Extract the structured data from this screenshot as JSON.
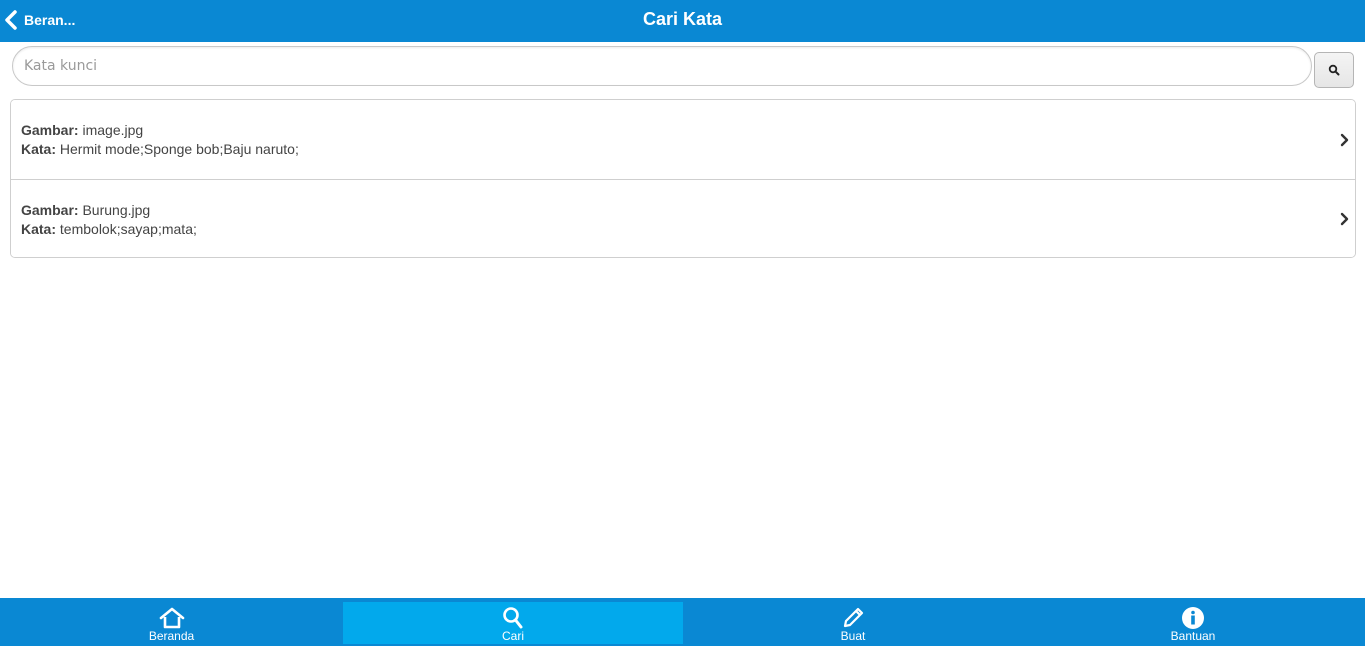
{
  "header": {
    "back_label": "Beran...",
    "title": "Cari Kata",
    "color": "#0a88d3"
  },
  "search": {
    "placeholder": "Kata kunci",
    "value": "",
    "button_icon": "search-icon"
  },
  "results": [
    {
      "gambar_label": "Gambar:",
      "gambar": "image.jpg",
      "kata_label": "Kata:",
      "kata": "Hermit mode;Sponge bob;Baju naruto;"
    },
    {
      "gambar_label": "Gambar:",
      "gambar": "Burung.jpg",
      "kata_label": "Kata:",
      "kata": "tembolok;sayap;mata;"
    }
  ],
  "navbar": {
    "items": [
      {
        "label": "Beranda",
        "icon": "home-icon",
        "active": false
      },
      {
        "label": "Cari",
        "icon": "search-icon",
        "active": true
      },
      {
        "label": "Buat",
        "icon": "pencil-icon",
        "active": false
      },
      {
        "label": "Bantuan",
        "icon": "info-icon",
        "active": false
      }
    ],
    "active_color": "#02a9ec"
  }
}
